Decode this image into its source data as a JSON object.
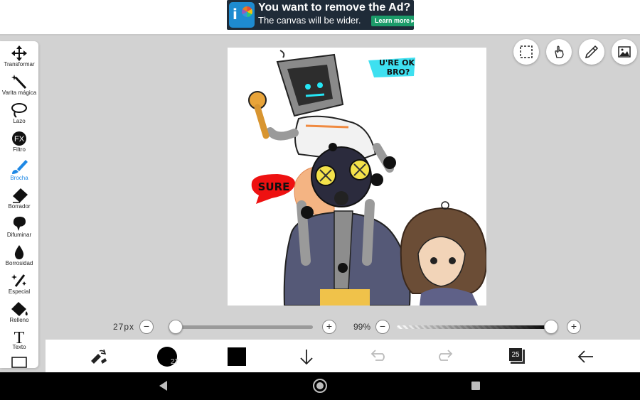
{
  "ad": {
    "title": "You want to remove the Ad?",
    "subtitle": "The canvas will be wider.",
    "button": "Learn more ▸"
  },
  "toolbar": {
    "items": [
      {
        "label": "Transformar",
        "icon": "move-arrows-icon"
      },
      {
        "label": "Varita mágica",
        "icon": "magic-wand-icon"
      },
      {
        "label": "Lazo",
        "icon": "lasso-icon"
      },
      {
        "label": "Filtro",
        "icon": "fx-icon",
        "icon_text": "FX"
      },
      {
        "label": "Brocha",
        "icon": "brush-icon",
        "active": true
      },
      {
        "label": "Borrador",
        "icon": "eraser-icon"
      },
      {
        "label": "Difuminar",
        "icon": "smudge-icon"
      },
      {
        "label": "Borrosidad",
        "icon": "blur-drop-icon"
      },
      {
        "label": "Especial",
        "icon": "special-sparkle-icon"
      },
      {
        "label": "Relleno",
        "icon": "fill-bucket-icon"
      },
      {
        "label": "Texto",
        "icon": "text-icon",
        "icon_text": "T"
      }
    ]
  },
  "canvas": {
    "bubble_top": "U'RE OK BRO?",
    "bubble_left": "SURE"
  },
  "sliders": {
    "size_label": "27px",
    "size_value": 0.05,
    "opacity_label": "99%",
    "opacity_value": 0.99,
    "minus": "−",
    "plus": "+"
  },
  "bottombar": {
    "brush_size": "27",
    "color": "#000000",
    "layers_count": "25"
  },
  "colors": {
    "accent": "#1e88e5",
    "ad_bg": "#1f2b38",
    "ad_button": "#1c9c6a"
  }
}
